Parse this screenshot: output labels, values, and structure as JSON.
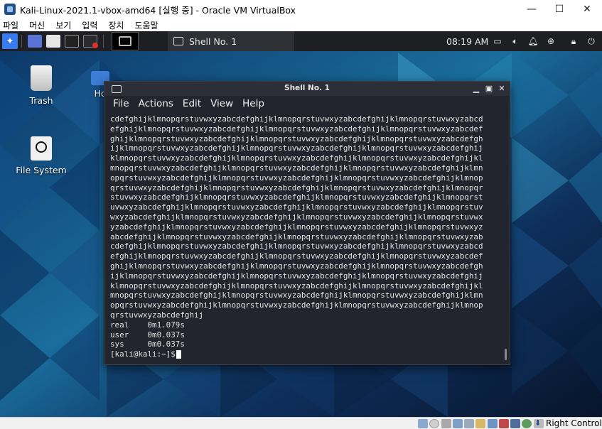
{
  "host_window": {
    "title": "Kali-Linux-2021.1-vbox-amd64 [실행 중] - Oracle VM VirtualBox",
    "minimize_glyph": "—",
    "maximize_glyph": "☐",
    "close_glyph": "✕",
    "menu": [
      "파일",
      "머신",
      "보기",
      "입력",
      "장치",
      "도움말"
    ]
  },
  "kali_panel": {
    "menu_icon": "kali-dragon-icon",
    "launchers": [
      "files-icon",
      "folder-icon",
      "terminal-icon",
      "browser-icon"
    ],
    "task": {
      "label": "Shell No. 1",
      "icon": "terminal-icon"
    },
    "clock": "08:19 AM",
    "tray": [
      "display-icon",
      "volume-icon",
      "bell-icon",
      "update-icon",
      "lock-icon",
      "power-icon"
    ]
  },
  "desktop": {
    "icons": [
      {
        "label": "Trash",
        "icon": "trash-icon"
      },
      {
        "label": "Ho",
        "icon": "home-folder-icon"
      },
      {
        "label": "File System",
        "icon": "drive-icon"
      }
    ]
  },
  "terminal": {
    "title": "Shell No. 1",
    "menu": [
      "File",
      "Actions",
      "Edit",
      "View",
      "Help"
    ],
    "lines": [
      "cdefghijklmnopqrstuvwxyzabcdefghijklmnopqrstuvwxyzabcdefghijklmnopqrstuvwxyzabcd",
      "efghijklmnopqrstuvwxyzabcdefghijklmnopqrstuvwxyzabcdefghijklmnopqrstuvwxyzabcdef",
      "ghijklmnopqrstuvwxyzabcdefghijklmnopqrstuvwxyzabcdefghijklmnopqrstuvwxyzabcdefgh",
      "ijklmnopqrstuvwxyzabcdefghijklmnopqrstuvwxyzabcdefghijklmnopqrstuvwxyzabcdefghij",
      "klmnopqrstuvwxyzabcdefghijklmnopqrstuvwxyzabcdefghijklmnopqrstuvwxyzabcdefghijkl",
      "mnopqrstuvwxyzabcdefghijklmnopqrstuvwxyzabcdefghijklmnopqrstuvwxyzabcdefghijklmn",
      "opqrstuvwxyzabcdefghijklmnopqrstuvwxyzabcdefghijklmnopqrstuvwxyzabcdefghijklmnop",
      "qrstuvwxyzabcdefghijklmnopqrstuvwxyzabcdefghijklmnopqrstuvwxyzabcdefghijklmnopqr",
      "stuvwxyzabcdefghijklmnopqrstuvwxyzabcdefghijklmnopqrstuvwxyzabcdefghijklmnopqrst",
      "uvwxyzabcdefghijklmnopqrstuvwxyzabcdefghijklmnopqrstuvwxyzabcdefghijklmnopqrstuv",
      "wxyzabcdefghijklmnopqrstuvwxyzabcdefghijklmnopqrstuvwxyzabcdefghijklmnopqrstuvwx",
      "yzabcdefghijklmnopqrstuvwxyzabcdefghijklmnopqrstuvwxyzabcdefghijklmnopqrstuvwxyz",
      "abcdefghijklmnopqrstuvwxyzabcdefghijklmnopqrstuvwxyzabcdefghijklmnopqrstuvwxyzab",
      "cdefghijklmnopqrstuvwxyzabcdefghijklmnopqrstuvwxyzabcdefghijklmnopqrstuvwxyzabcd",
      "efghijklmnopqrstuvwxyzabcdefghijklmnopqrstuvwxyzabcdefghijklmnopqrstuvwxyzabcdef",
      "ghijklmnopqrstuvwxyzabcdefghijklmnopqrstuvwxyzabcdefghijklmnopqrstuvwxyzabcdefgh",
      "ijklmnopqrstuvwxyzabcdefghijklmnopqrstuvwxyzabcdefghijklmnopqrstuvwxyzabcdefghij",
      "klmnopqrstuvwxyzabcdefghijklmnopqrstuvwxyzabcdefghijklmnopqrstuvwxyzabcdefghijkl",
      "mnopqrstuvwxyzabcdefghijklmnopqrstuvwxyzabcdefghijklmnopqrstuvwxyzabcdefghijklmn",
      "opqrstuvwxyzabcdefghijklmnopqrstuvwxyzabcdefghijklmnopqrstuvwxyzabcdefghijklmnop",
      "qrstuvwxyzabcdefghij",
      "real    0m1.079s",
      "user    0m0.037s",
      "sys     0m0.037s"
    ],
    "prompt": "[kali@kali:~]$"
  },
  "status_bar": {
    "icons": [
      "hdd-icon",
      "optical-drive-icon",
      "audio-icon",
      "network-icon",
      "usb-icon",
      "shared-folder-icon",
      "display-icon",
      "recording-icon",
      "vtx-icon",
      "cpu-icon",
      "mouse-integration-icon"
    ],
    "host_key_label": "Right Control"
  },
  "colors": {
    "terminal_bg": "#23252e",
    "panel_bg": "#1d1f22",
    "kali_blue": "#367bf0"
  }
}
